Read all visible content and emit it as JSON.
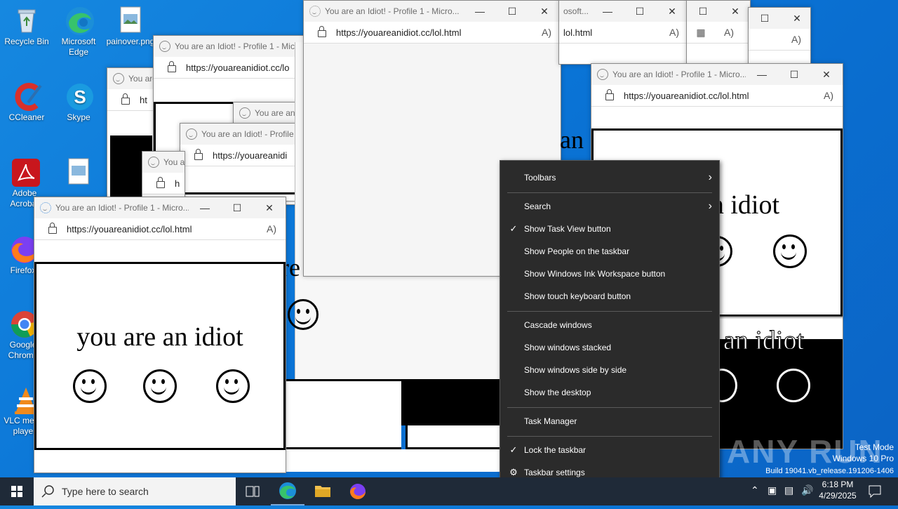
{
  "desktop": {
    "icons": [
      {
        "label": "Recycle Bin"
      },
      {
        "label": "Microsoft Edge"
      },
      {
        "label": "painover.png"
      },
      {
        "label": "CCleaner"
      },
      {
        "label": "Skype"
      },
      {
        "label": "Adobe Acrobat"
      },
      {
        "label": "Firefox"
      },
      {
        "label": "Google Chrome"
      },
      {
        "label": "VLC media player"
      }
    ]
  },
  "window": {
    "title": "You are an Idiot! - Profile 1 - Micro...",
    "title_short": "You are an Idiot! - Profile 1 - Micro...",
    "title_frag1": "You are",
    "title_frag2": "You are an Id",
    "title_frag3": "You a",
    "title_frag4": "You are an Idiot! - Profile 1 - Micro...",
    "title_frag5": "osoft...",
    "url": "https://youareanidiot.cc/lol.html",
    "url_frag1": "https://youareanidiot.cc/lo",
    "url_frag2": "https://youareanidi",
    "url_frag3": "ht",
    "url_frag4": "h",
    "url_frag5": "lol.html",
    "page_text": "you are an idiot",
    "page_text_frag1": "an idiot",
    "page_text_frag2": "an idiot",
    "page_text_frag3": "an",
    "page_text_frag4": "re"
  },
  "context_menu": {
    "items": [
      {
        "label": "Toolbars",
        "checked": false,
        "submenu": true
      },
      {
        "label": "Search",
        "checked": false,
        "submenu": true
      },
      {
        "label": "Show Task View button",
        "checked": true,
        "submenu": false
      },
      {
        "label": "Show People on the taskbar",
        "checked": false,
        "submenu": false
      },
      {
        "label": "Show Windows Ink Workspace button",
        "checked": false,
        "submenu": false
      },
      {
        "label": "Show touch keyboard button",
        "checked": false,
        "submenu": false
      },
      {
        "label": "Cascade windows",
        "checked": false,
        "submenu": false
      },
      {
        "label": "Show windows stacked",
        "checked": false,
        "submenu": false
      },
      {
        "label": "Show windows side by side",
        "checked": false,
        "submenu": false
      },
      {
        "label": "Show the desktop",
        "checked": false,
        "submenu": false
      },
      {
        "label": "Task Manager",
        "checked": false,
        "submenu": false
      },
      {
        "label": "Lock the taskbar",
        "checked": true,
        "submenu": false
      },
      {
        "label": "Taskbar settings",
        "checked": false,
        "submenu": false
      }
    ]
  },
  "taskbar": {
    "search_placeholder": "Type here to search",
    "time": "6:18 PM",
    "date": "4/29/2025"
  },
  "watermark": {
    "line1": "Test Mode",
    "line2": "Windows 10 Pro",
    "line3": "Build 19041.vb_release.191206-1406",
    "brand": "ANY RUN"
  },
  "colors": {
    "desktop": "#0a74d6",
    "menu_bg": "#2b2b2b",
    "taskbar_bg": "#1f2a38"
  }
}
